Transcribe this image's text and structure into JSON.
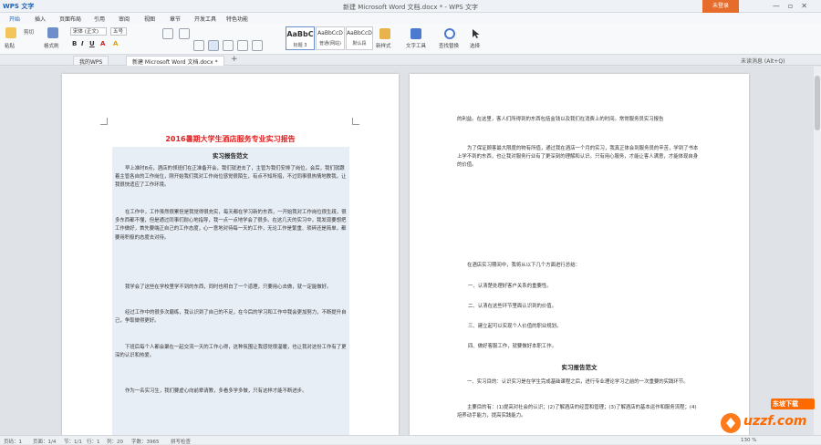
{
  "titlebar": {
    "app_name": "WPS 文字",
    "window_title": "新建 Microsoft Word 文档.docx * - WPS 文字",
    "login_button": "未登录"
  },
  "menu_tabs": [
    "开始",
    "插入",
    "页面布局",
    "引用",
    "审阅",
    "视图",
    "章节",
    "开发工具",
    "特色功能"
  ],
  "ribbon": {
    "paste": "粘贴",
    "cut": "剪切",
    "format_painter": "格式刷",
    "font_name": "宋体 (正文)",
    "font_size": "五号",
    "styles": [
      {
        "sample": "AaBbC",
        "name": "标题 3"
      },
      {
        "sample": "AaBbCcD",
        "name": "普通(网站)"
      },
      {
        "sample": "AaBbCcD",
        "name": "默认段"
      }
    ],
    "new_style": "新样式",
    "text_tools": "文字工具",
    "find_replace": "查找替换",
    "select": "选择"
  },
  "doc_tabs": {
    "tab1": "我的WPS",
    "tab2": "新建 Microsoft Word 文档.docx *",
    "right_text": "未读消息 (Alt+Q)"
  },
  "page1": {
    "title": "2016暑期大学生酒店服务专业实习报告",
    "subtitle": "实习报告范文",
    "paragraphs": [
      "早上准时8点，酒店的领班们在正准备开会，我们就进去了，主管为我们安排了岗位，会后，我们就跟着主管各自的工作岗位，刚开始我们我对工作岗位感觉很陌生，有点不知所措，不过同事很热情地教我，让我很快适应了工作环境。",
      "在工作中，工作虽然很累但是我觉得很充实，每天都在学习新的东西，一开始我对工作岗位很生疏，很多东西都不懂，但是通过同事们耐心地指导，我一点一点地学会了很多。在这几天的实习中，我发现要想把工作做好，首先要端正自己的工作态度，心一意地对待每一天的工作，无论工作是繁重、琐碎还是简单，都要用积极的态度去对待。",
      "我学会了这些在学校里学不到的东西，同时也明白了一个道理，只要用心去做，就一定能做好。",
      "经过工作中的很多次磨练，我认识到了自己的不足，在今后的学习和工作中我会更加努力，不断提升自己，争取做得更好。",
      "下班后每个人都会聚在一起交流一天的工作心得，这种氛围让我感觉很温暖，也让我对这份工作有了更深的认识和热爱。",
      "作为一名实习生，我们要虚心向前辈请教，多看多学多做，只有这样才能不断进步。"
    ]
  },
  "page2": {
    "paragraphs_top": [
      "的利益。在这里，客人们所得到的东西包括金钱以及我们在消费上的时间。常常服务员实习报告",
      "为了保证顾客最大限度的物有所值，通过我在酒店一个月的实习，我真正体会到服务员的辛苦，学到了书本上学不到的东西，也让我对服务行业有了更深刻的理解和认识。只有用心服务，才能让客人满意，才能体现自身的价值。"
    ],
    "list_intro": "在酒店实习期间中，我将从以下几个方面进行总结：",
    "list": [
      "一、认清楚处理好客户关系的重要性。",
      "二、认清在这些环节里面认识到的价值。",
      "三、建立起可以实现个人价值的职业规划。",
      "四、做好客服工作，就要做好本职工作。"
    ],
    "subtitle": "实习报告范文",
    "paragraphs_bottom": [
      "一、实习目的：认识实习是在学生完成基础课程之后，进行专业理论学习之前的一次重要的实践环节。",
      "主要目的有：(1)提高对社会的认识；(2)了解酒店的经营和管理；(3)了解酒店的基本运作和服务流程；(4)培养动手能力，提高实践能力。"
    ]
  },
  "status_bar": {
    "page": "页码：1",
    "pages": "页面：1/4",
    "section": "节：1/1",
    "row": "行：1",
    "column": "列：20",
    "word_count": "字数：3965",
    "spell_check": "拼写检查",
    "zoom": "130 %"
  },
  "watermark": {
    "brand": "uzzf.com",
    "badge": "东坡下载"
  },
  "colors": {
    "accent": "#1b62b8",
    "login_bg": "#e56c2a",
    "title_red": "#e02020"
  }
}
